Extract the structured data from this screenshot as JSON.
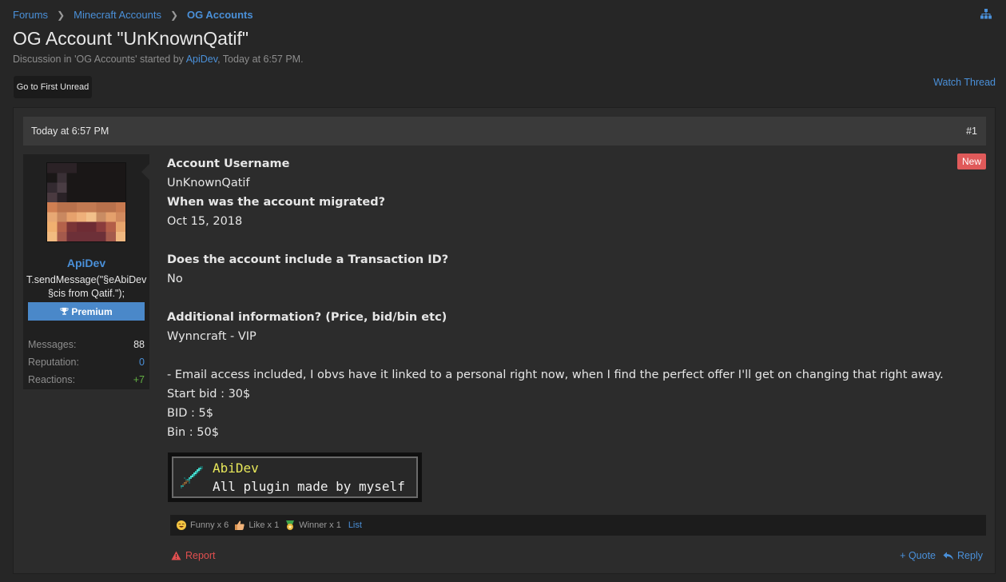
{
  "breadcrumb": {
    "items": [
      "Forums",
      "Minecraft Accounts",
      "OG Accounts"
    ],
    "separator": ">"
  },
  "thread": {
    "title": "OG Account \"UnKnownQatif\"",
    "subtitle_prefix": "Discussion in 'OG Accounts' started by",
    "author": "ApiDev",
    "subtitle_suffix": ", Today at 6:57 PM.",
    "first_unread_label": "Go to First Unread",
    "watch_label": "Watch Thread"
  },
  "post": {
    "date": "Today at 6:57 PM",
    "number": "#1",
    "new_badge": "New",
    "user": {
      "name": "ApiDev",
      "title": "T.sendMessage(\"§eAbiDev §cis from Qatif.\");",
      "badge": "Premium",
      "stats": [
        {
          "label": "Messages:",
          "value": "88",
          "color": "#e6e6e6"
        },
        {
          "label": "Reputation:",
          "value": "0",
          "color": "#4a90d9"
        },
        {
          "label": "Reactions:",
          "value": "+7",
          "color": "#63b043"
        }
      ]
    },
    "body": {
      "q1": "Account Username",
      "a1": "UnKnownQatif",
      "q2": "When was the account migrated?",
      "a2": "Oct 15, 2018",
      "q3": "Does the account include a Transaction ID?",
      "a3": "No",
      "q4": "Additional information? (Price, bid/bin etc)",
      "a4": "Wynncraft - VIP",
      "line5": "- Email access included, I obvs have it linked to a personal right now, when I find the perfect offer I'll get on changing that right away.",
      "line6": "Start bid : 30$",
      "line7": "BID : 5$",
      "line8": "Bin : 50$"
    },
    "signature": {
      "name": "AbiDev",
      "text": "All plugin made by myself",
      "icon": "diamond-sword-icon"
    },
    "reactions": [
      {
        "label": "Funny x 6",
        "icon": "funny-icon"
      },
      {
        "label": "Like x 1",
        "icon": "like-icon"
      },
      {
        "label": "Winner x 1",
        "icon": "winner-icon"
      }
    ],
    "reactions_list_label": "List",
    "actions": {
      "report": "Report",
      "quote": "+ Quote",
      "reply": "Reply"
    }
  },
  "colors": {
    "accent": "#4a90d9",
    "new_badge": "#e05a5a",
    "premium": "#4a88c9",
    "report": "#e04f4f"
  }
}
